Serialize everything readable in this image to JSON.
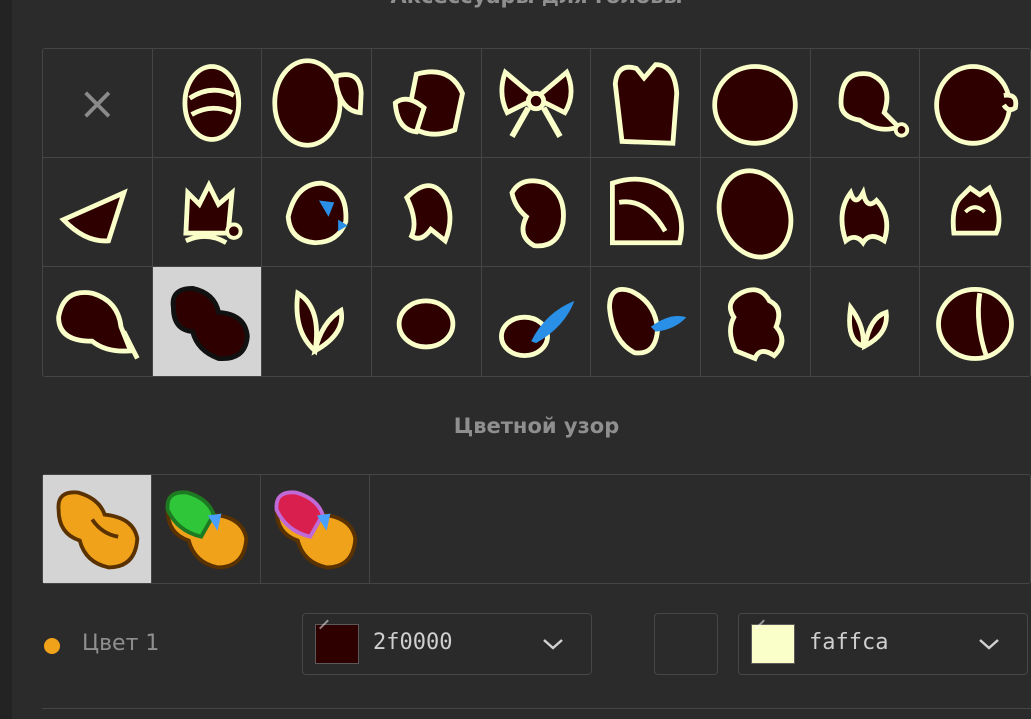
{
  "sections": {
    "head_accessories_title": "Аксессуары для головы",
    "color_pattern_title": "Цветной узор"
  },
  "accessories": {
    "selected_index": 19,
    "items": [
      {
        "kind": "none",
        "icon": "close-icon",
        "label": "×"
      },
      {
        "kind": "item",
        "icon": "wrapped-hat-icon"
      },
      {
        "kind": "item",
        "icon": "wide-brim-hat-icon"
      },
      {
        "kind": "item",
        "icon": "top-hat-icon"
      },
      {
        "kind": "item",
        "icon": "bow-icon"
      },
      {
        "kind": "item",
        "icon": "tall-hat-icon"
      },
      {
        "kind": "item",
        "icon": "round-cap-icon"
      },
      {
        "kind": "item",
        "icon": "pompom-cap-icon"
      },
      {
        "kind": "item",
        "icon": "ball-cap-icon"
      },
      {
        "kind": "item",
        "icon": "cone-hat-icon"
      },
      {
        "kind": "item",
        "icon": "crown-icon"
      },
      {
        "kind": "item",
        "icon": "jeweled-tiara-icon"
      },
      {
        "kind": "item",
        "icon": "horn-icon"
      },
      {
        "kind": "item",
        "icon": "bean-cap-icon"
      },
      {
        "kind": "item",
        "icon": "folded-hood-icon"
      },
      {
        "kind": "item",
        "icon": "large-hood-icon"
      },
      {
        "kind": "item",
        "icon": "flame-hair-icon"
      },
      {
        "kind": "item",
        "icon": "small-tiara-icon"
      },
      {
        "kind": "item",
        "icon": "tassel-cap-icon"
      },
      {
        "kind": "item",
        "icon": "bean-shape-icon"
      },
      {
        "kind": "item",
        "icon": "leaf-sprout-icon"
      },
      {
        "kind": "item",
        "icon": "oval-cap-icon"
      },
      {
        "kind": "item",
        "icon": "feather-cap-icon"
      },
      {
        "kind": "item",
        "icon": "feather-hat-icon"
      },
      {
        "kind": "item",
        "icon": "curly-hair-icon"
      },
      {
        "kind": "item",
        "icon": "small-leaves-icon"
      },
      {
        "kind": "item",
        "icon": "round-helmet-icon"
      }
    ]
  },
  "patterns": {
    "selected_index": 0,
    "items": [
      {
        "icon": "solid-pattern-icon",
        "colors": [
          "#f0a21a"
        ]
      },
      {
        "icon": "two-tone-pattern-icon",
        "colors": [
          "#2fc63a",
          "#f0a21a",
          "#4aa0ff"
        ]
      },
      {
        "icon": "tri-tone-pattern-icon",
        "colors": [
          "#d81f4e",
          "#f0a21a",
          "#4aa0ff",
          "#c06ad8"
        ]
      }
    ]
  },
  "color_row": {
    "label": "Цвет 1",
    "dot_color": "#f0a21a",
    "primary": {
      "hex": "2f0000",
      "swatch": "#2f0000"
    },
    "secondary": {
      "hex": "faffca",
      "swatch": "#faffca"
    }
  },
  "theme": {
    "fill": "#2f0000",
    "outline": "#faffca",
    "accent_blue": "#2a8fe6"
  }
}
